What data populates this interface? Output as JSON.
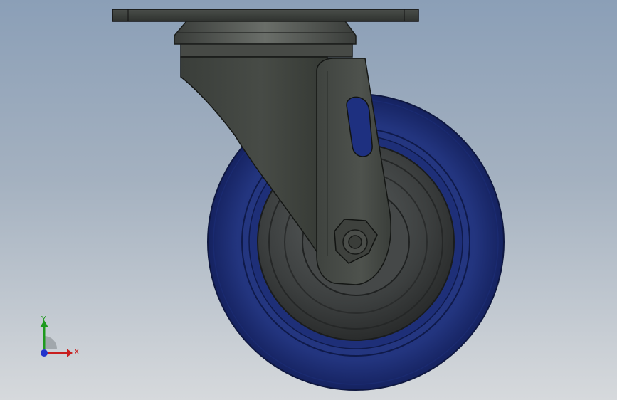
{
  "viewport": {
    "background_top": "#8b9fb7",
    "background_bottom": "#d6d9dc"
  },
  "model": {
    "wheel_color": "#1f2f7a",
    "hub_color": "#3a3d3d",
    "bracket_color": "#3c403c"
  },
  "triad": {
    "x_label": "X",
    "y_label": "Y",
    "x_color": "#c81e1e",
    "y_color": "#1e9a1e",
    "z_color": "#2233cc"
  }
}
